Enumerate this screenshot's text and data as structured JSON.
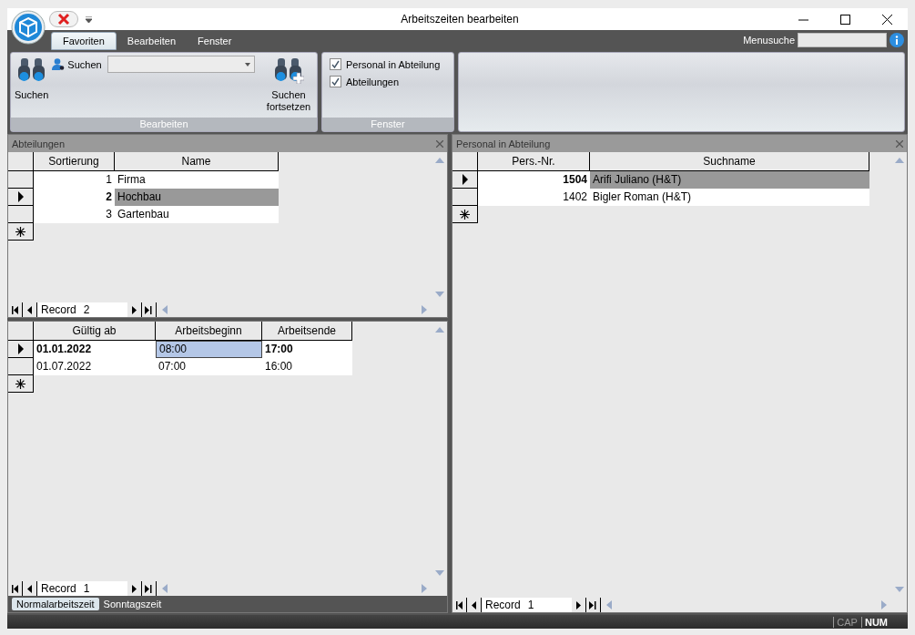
{
  "window": {
    "title": "Arbeitszeiten bearbeiten"
  },
  "ribbon": {
    "tabs": [
      {
        "label": "Favoriten",
        "selected": true
      },
      {
        "label": "Bearbeiten",
        "selected": false
      },
      {
        "label": "Fenster",
        "selected": false
      }
    ],
    "menu_search_label": "Menusuche",
    "search_button": "Suchen",
    "search_label": "Suchen",
    "continue_button": "Suchen fortsetzen",
    "edit_group": "Bearbeiten",
    "window_options": [
      {
        "label": "Personal in Abteilung",
        "checked": true
      },
      {
        "label": "Abteilungen",
        "checked": true
      }
    ],
    "window_group": "Fenster"
  },
  "departments": {
    "title": "Abteilungen",
    "columns": [
      "Sortierung",
      "Name"
    ],
    "rows": [
      {
        "cells": [
          "1",
          "Firma"
        ],
        "selected": false
      },
      {
        "cells": [
          "2",
          "Hochbau"
        ],
        "selected": true
      },
      {
        "cells": [
          "3",
          "Gartenbau"
        ],
        "selected": false
      }
    ],
    "record_label": "Record",
    "record_value": "2"
  },
  "working_hours": {
    "columns": [
      "Gültig ab",
      "Arbeitsbeginn",
      "Arbeitsende"
    ],
    "rows": [
      {
        "cells": [
          "01.01.2022",
          "08:00",
          "17:00"
        ],
        "selected": true
      },
      {
        "cells": [
          "01.07.2022",
          "07:00",
          "16:00"
        ],
        "selected": false
      }
    ],
    "record_label": "Record",
    "record_value": "1",
    "tabs": [
      {
        "label": "Normalarbeitszeit",
        "selected": true
      },
      {
        "label": "Sonntagszeit",
        "selected": false
      }
    ]
  },
  "staff": {
    "title": "Personal in Abteilung",
    "columns": [
      "Pers.-Nr.",
      "Suchname"
    ],
    "rows": [
      {
        "cells": [
          "1504",
          "Arifi Juliano (H&T)"
        ],
        "selected": true
      },
      {
        "cells": [
          "1402",
          "Bigler Roman (H&T)"
        ],
        "selected": false
      }
    ],
    "record_label": "Record",
    "record_value": "1"
  },
  "status_bar": {
    "indicators": [
      {
        "label": "CAP",
        "on": false
      },
      {
        "label": "NUM",
        "on": true
      }
    ]
  }
}
